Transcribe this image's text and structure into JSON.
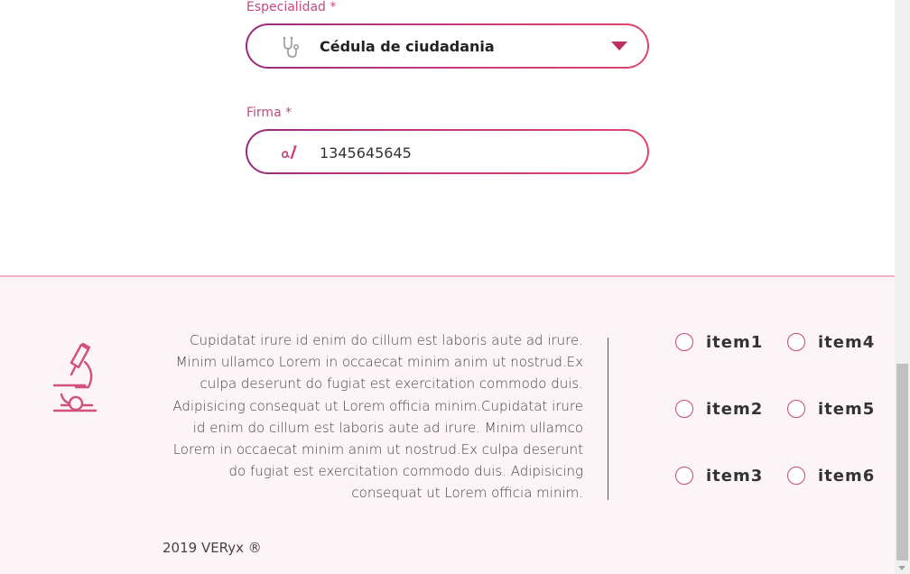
{
  "form": {
    "especialidad": {
      "label": "Especialidad *",
      "value": "Cédula de ciudadania",
      "icon": "stethoscope-icon"
    },
    "firma": {
      "label": "Firma *",
      "value": "1345645645",
      "icon": "signature-icon"
    }
  },
  "footer": {
    "icon": "microscope-icon",
    "text": "Cupidatat irure id enim do cillum est laboris aute ad irure. Minim ullamco Lorem in occaecat minim anim ut nostrud.Ex culpa deserunt do fugiat est exercitation commodo duis. Adipisicing consequat ut Lorem officia minim.Cupidatat irure id enim do cillum est laboris aute ad irure. Minim ullamco Lorem in occaecat minim anim ut nostrud.Ex culpa deserunt do fugiat est exercitation commodo duis. Adipisicing consequat ut Lorem officia minim.",
    "items": [
      {
        "label": "item1"
      },
      {
        "label": "item2"
      },
      {
        "label": "item3"
      },
      {
        "label": "item4"
      },
      {
        "label": "item5"
      },
      {
        "label": "item6"
      }
    ],
    "copyright": "2019 VERyx ®"
  },
  "colors": {
    "accent": "#c4497f",
    "gradient_start": "#9b2b7a",
    "gradient_end": "#e0466a",
    "footer_bg": "#fcf4f6"
  }
}
